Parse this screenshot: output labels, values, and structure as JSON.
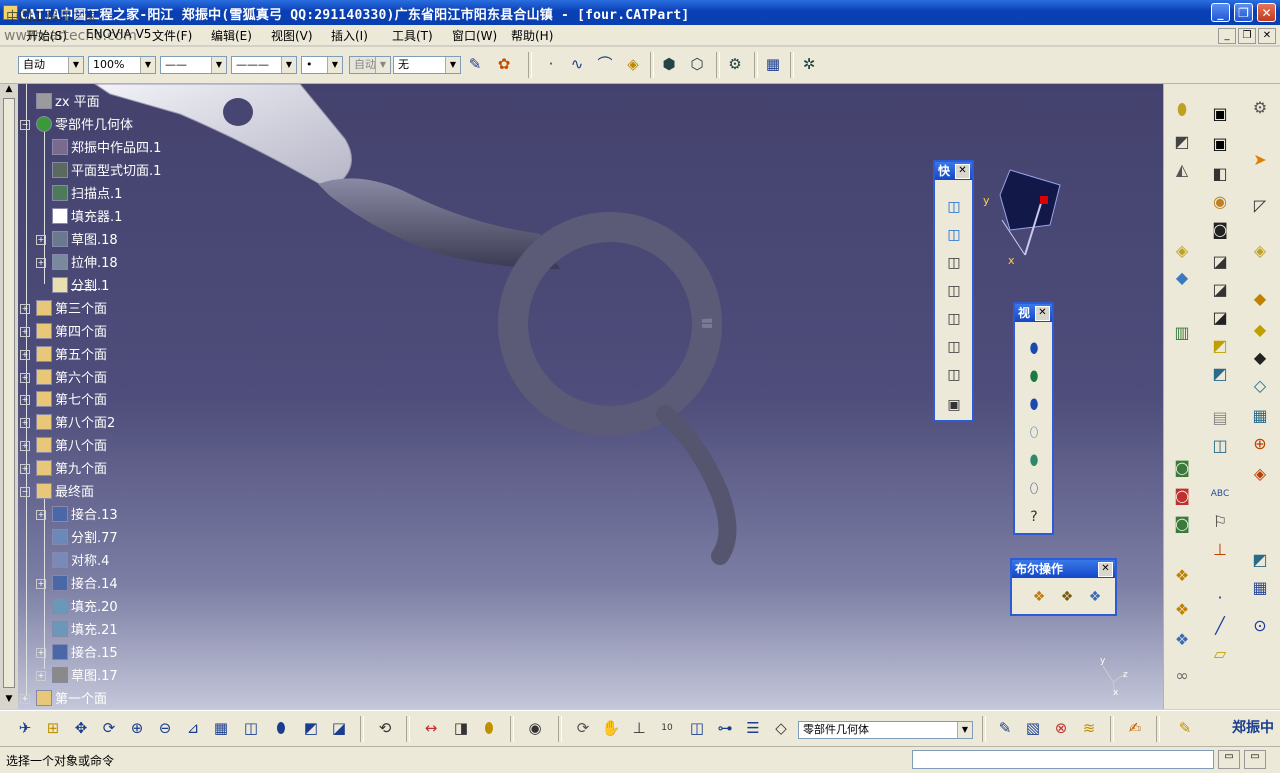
{
  "window": {
    "title": "CATIA中国工程之家-阳江   郑振中(雪狐真弓 QQ:291140330)广东省阳江市阳东县合山镇 - [four.CATPart]",
    "watermark": "中国工程师之家",
    "watermark_url": "www.cartecho.com",
    "min_label": "_",
    "max_label": "❐",
    "close_label": "✕"
  },
  "menubar": {
    "items": [
      "开始(S)",
      "ENOVIA V5",
      "文件(F)",
      "编辑(E)",
      "视图(V)",
      "插入(I)",
      "工具(T)",
      "窗口(W)",
      "帮助(H)"
    ]
  },
  "toolbar": {
    "combo_auto": "自动",
    "combo_zoom": "100%",
    "combo_line1": "——",
    "combo_line2": "———",
    "combo_point": "•",
    "combo_auto2": "自动",
    "combo_none": "无"
  },
  "tree": {
    "nodes": [
      {
        "label": "zx 平面",
        "icon": "plane-icon"
      },
      {
        "label": "零部件几何体",
        "icon": "part-body-icon"
      },
      {
        "label": "郑振中作品四.1",
        "icon": "feature-icon"
      },
      {
        "label": "平面型式切面.1",
        "icon": "feature-icon"
      },
      {
        "label": "扫描点.1",
        "icon": "feature-icon"
      },
      {
        "label": "填充器.1",
        "icon": "fill-icon"
      },
      {
        "label": "草图.18",
        "icon": "sketch-icon"
      },
      {
        "label": "拉伸.18",
        "icon": "extrude-icon"
      },
      {
        "label": "分割.1",
        "icon": "split-icon"
      },
      {
        "label": "第三个面",
        "icon": "geom-set-icon"
      },
      {
        "label": "第四个面",
        "icon": "geom-set-icon"
      },
      {
        "label": "第五个面",
        "icon": "geom-set-icon"
      },
      {
        "label": "第六个面",
        "icon": "geom-set-icon"
      },
      {
        "label": "第七个面",
        "icon": "geom-set-icon"
      },
      {
        "label": "第八个面2",
        "icon": "geom-set-icon"
      },
      {
        "label": "第八个面",
        "icon": "geom-set-icon"
      },
      {
        "label": "第九个面",
        "icon": "geom-set-icon"
      },
      {
        "label": "最终面",
        "icon": "geom-set-icon"
      },
      {
        "label": "接合.13",
        "icon": "join-icon"
      },
      {
        "label": "分割.77",
        "icon": "split-icon"
      },
      {
        "label": "对称.4",
        "icon": "symmetry-icon"
      },
      {
        "label": "接合.14",
        "icon": "join-icon"
      },
      {
        "label": "填充.20",
        "icon": "fill-icon"
      },
      {
        "label": "填充.21",
        "icon": "fill-icon"
      },
      {
        "label": "接合.15",
        "icon": "join-icon"
      },
      {
        "label": "草图.17",
        "icon": "sketch-icon"
      },
      {
        "label": "第一个面",
        "icon": "geom-set-icon"
      }
    ]
  },
  "float_quick": {
    "title": "快",
    "close": "✕"
  },
  "float_view": {
    "title": "视",
    "close": "✕"
  },
  "float_boolean": {
    "title": "布尔操作",
    "close": "✕"
  },
  "compass": {
    "x_label": "x",
    "y_label": "y"
  },
  "axis": {
    "x": "x",
    "y": "y",
    "z": "z"
  },
  "bottombar": {
    "body_combo": "零部件几何体",
    "user_label": "郑振中"
  },
  "status": {
    "message": "选择一个对象或命令"
  }
}
